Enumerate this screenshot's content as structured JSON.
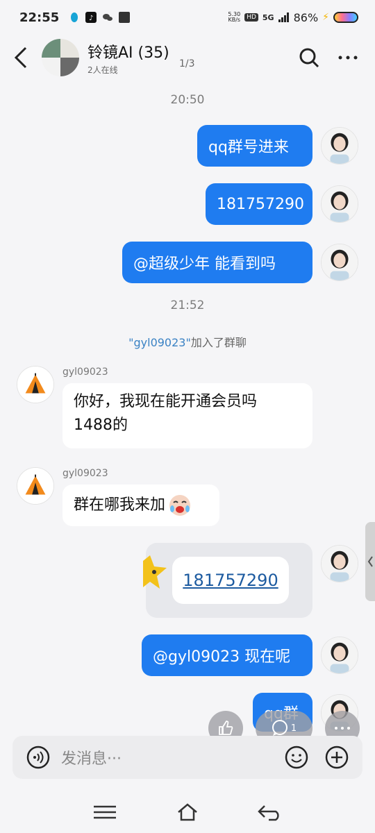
{
  "status_bar": {
    "time": "22:55",
    "speed_top": "5.30",
    "speed_bottom": "KB/s",
    "hd": "HD",
    "network": "5G",
    "battery": "86%"
  },
  "header": {
    "title": "铃镜AI (35)",
    "subtitle": "2人在线",
    "page_indicator": "1/3"
  },
  "timestamps": [
    "20:50",
    "21:52"
  ],
  "system_message": {
    "user": "\"gyl09023\"",
    "text": "加入了群聊"
  },
  "messages": {
    "out1": "qq群号进来",
    "out2": "181757290",
    "out3": "@超级少年  能看到吗",
    "in1_nick": "gyl09023",
    "in1_line1": "你好，我现在能开通会员吗",
    "in1_line2": "1488的",
    "in2_nick": "gyl09023",
    "in2_text": "群在哪我来加",
    "card_link": "181757290",
    "out4": "@gyl09023  现在呢",
    "out5": "qq群"
  },
  "floating": {
    "comment_count": "1"
  },
  "input": {
    "placeholder": "发消息···"
  },
  "colors": {
    "outgoing_bubble": "#1f7cf0",
    "link": "#1d5ba0",
    "highlight": "#3a82c4"
  }
}
